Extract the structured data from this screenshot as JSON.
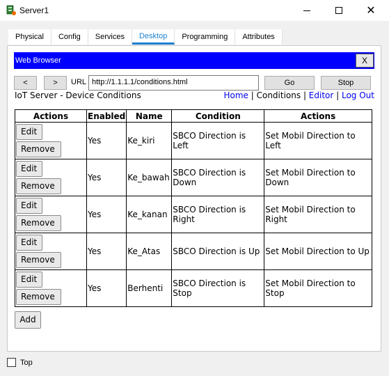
{
  "window": {
    "title": "Server1",
    "minimize_icon": "minimize-icon",
    "maximize_icon": "maximize-icon",
    "close_symbol": "✕"
  },
  "tabs": [
    {
      "label": "Physical"
    },
    {
      "label": "Config"
    },
    {
      "label": "Services"
    },
    {
      "label": "Desktop",
      "active": true
    },
    {
      "label": "Programming"
    },
    {
      "label": "Attributes"
    }
  ],
  "browser": {
    "title": "Web Browser",
    "close_label": "X",
    "back_label": "<",
    "forward_label": ">",
    "url_label": "URL",
    "url_value": "http://1.1.1.1/conditions.html",
    "go_label": "Go",
    "stop_label": "Stop"
  },
  "page": {
    "heading": "IoT Server - Device Conditions",
    "nav": {
      "home": "Home",
      "sep1": " | ",
      "conditions": "Conditions",
      "sep2": " | ",
      "editor": "Editor",
      "sep3": " | ",
      "logout": "Log Out"
    },
    "table_headers": [
      "Actions",
      "Enabled",
      "Name",
      "Condition",
      "Actions"
    ],
    "edit_label": "Edit",
    "remove_label": "Remove",
    "rows": [
      {
        "enabled": "Yes",
        "name": "Ke_kiri",
        "condition": "SBCO Direction is Left",
        "action": "Set Mobil Direction to Left"
      },
      {
        "enabled": "Yes",
        "name": "Ke_bawah",
        "condition": "SBCO Direction is Down",
        "action": "Set Mobil Direction to Down"
      },
      {
        "enabled": "Yes",
        "name": "Ke_kanan",
        "condition": "SBCO Direction is Right",
        "action": "Set Mobil Direction to Right"
      },
      {
        "enabled": "Yes",
        "name": "Ke_Atas",
        "condition": "SBCO Direction is Up",
        "action": "Set Mobil Direction to Up"
      },
      {
        "enabled": "Yes",
        "name": "Berhenti",
        "condition": "SBCO Direction is Stop",
        "action": "Set Mobil Direction to Stop"
      }
    ],
    "add_label": "Add"
  },
  "footer": {
    "top_label": "Top",
    "top_checked": false
  },
  "colors": {
    "accent_tab": "#1a7fd0",
    "browser_titlebar": "#0000ff",
    "link": "#0000ee"
  }
}
